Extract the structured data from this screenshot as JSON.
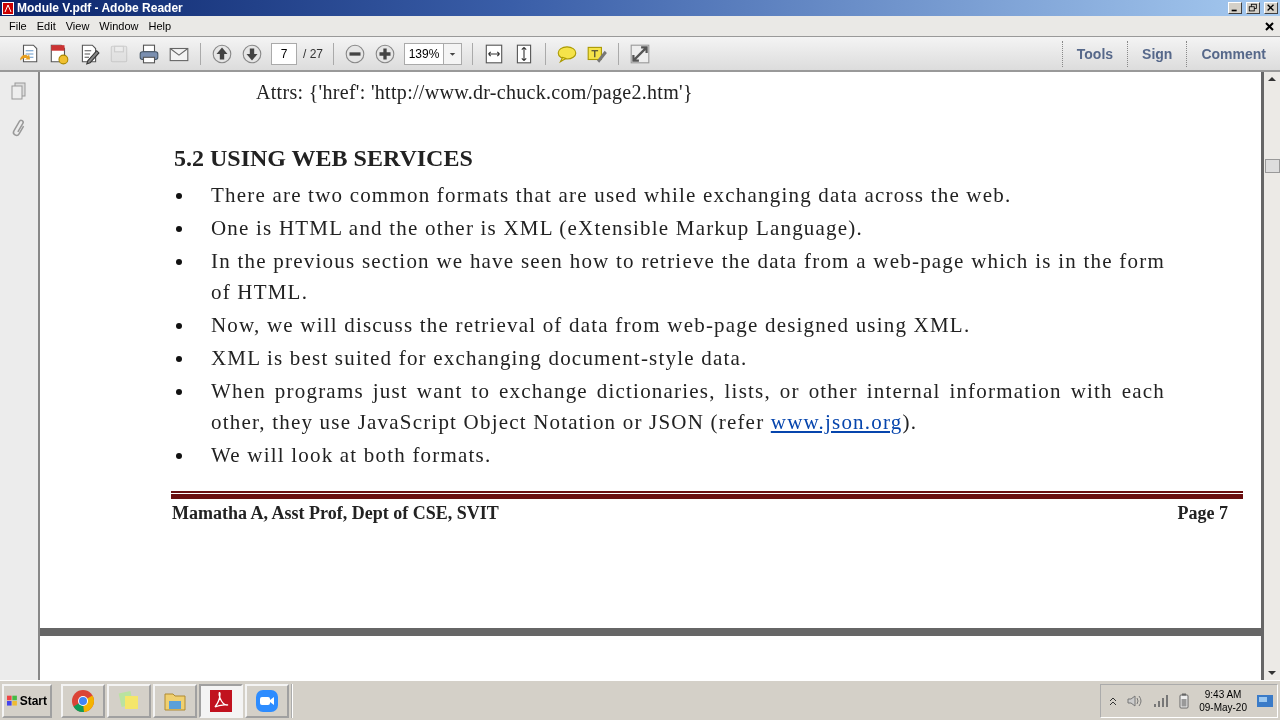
{
  "window": {
    "title": "Module V.pdf - Adobe Reader"
  },
  "menu": [
    "File",
    "Edit",
    "View",
    "Window",
    "Help"
  ],
  "toolbar": {
    "groups": [
      [
        {
          "kind": "open",
          "disabled": false
        },
        {
          "kind": "create",
          "disabled": false
        },
        {
          "kind": "edit",
          "disabled": false
        },
        {
          "kind": "save",
          "disabled": true
        },
        {
          "kind": "print",
          "disabled": false
        },
        {
          "kind": "email",
          "disabled": false
        }
      ],
      [
        {
          "kind": "prev",
          "disabled": false
        },
        {
          "kind": "next",
          "disabled": false
        },
        {
          "kind": "page_field"
        }
      ],
      [
        {
          "kind": "zoom_out",
          "disabled": false
        },
        {
          "kind": "zoom_in",
          "disabled": false
        },
        {
          "kind": "zoom_field"
        }
      ],
      [
        {
          "kind": "fit_page",
          "disabled": false
        },
        {
          "kind": "fit_width",
          "disabled": false
        }
      ],
      [
        {
          "kind": "comment",
          "disabled": false
        },
        {
          "kind": "highlight",
          "disabled": false
        }
      ],
      [
        {
          "kind": "fullscreen",
          "disabled": false
        }
      ]
    ],
    "page_number": "7",
    "page_count": "/ 27",
    "zoom": "139%",
    "panes": [
      "Tools",
      "Sign",
      "Comment"
    ]
  },
  "document": {
    "attrs_line": "Attrs: {'href': 'http://www.dr-chuck.com/page2.htm'}",
    "heading": "5.2 USING WEB SERVICES",
    "bullets": [
      {
        "text": "There are two common formats that are used while exchanging data across the web."
      },
      {
        "text": "One is HTML and the other is XML (eXtensible Markup Language)."
      },
      {
        "text": "In the previous section we have seen how to retrieve the data from a web-page which is in the form of HTML."
      },
      {
        "text": "Now, we will discuss the retrieval of data from web-page designed using XML."
      },
      {
        "text": "XML is best suited for exchanging document-style data."
      },
      {
        "text": "When programs just want to exchange dictionaries, lists, or other internal information with each other, they use JavaScript Object Notation or JSON (refer ",
        "link": "www.json.org",
        "after": ")."
      },
      {
        "text": "We will look at both formats."
      }
    ],
    "footer_left": "Mamatha A, Asst Prof, Dept of CSE, SVIT",
    "footer_right": "Page 7"
  },
  "taskbar": {
    "start": "Start",
    "apps": [
      {
        "kind": "chrome",
        "selected": false
      },
      {
        "kind": "notes",
        "selected": false
      },
      {
        "kind": "explorer",
        "selected": false
      },
      {
        "kind": "acrobat",
        "selected": true
      },
      {
        "kind": "zoom",
        "selected": false
      }
    ],
    "time": "9:43 AM",
    "date": "09-May-20"
  }
}
